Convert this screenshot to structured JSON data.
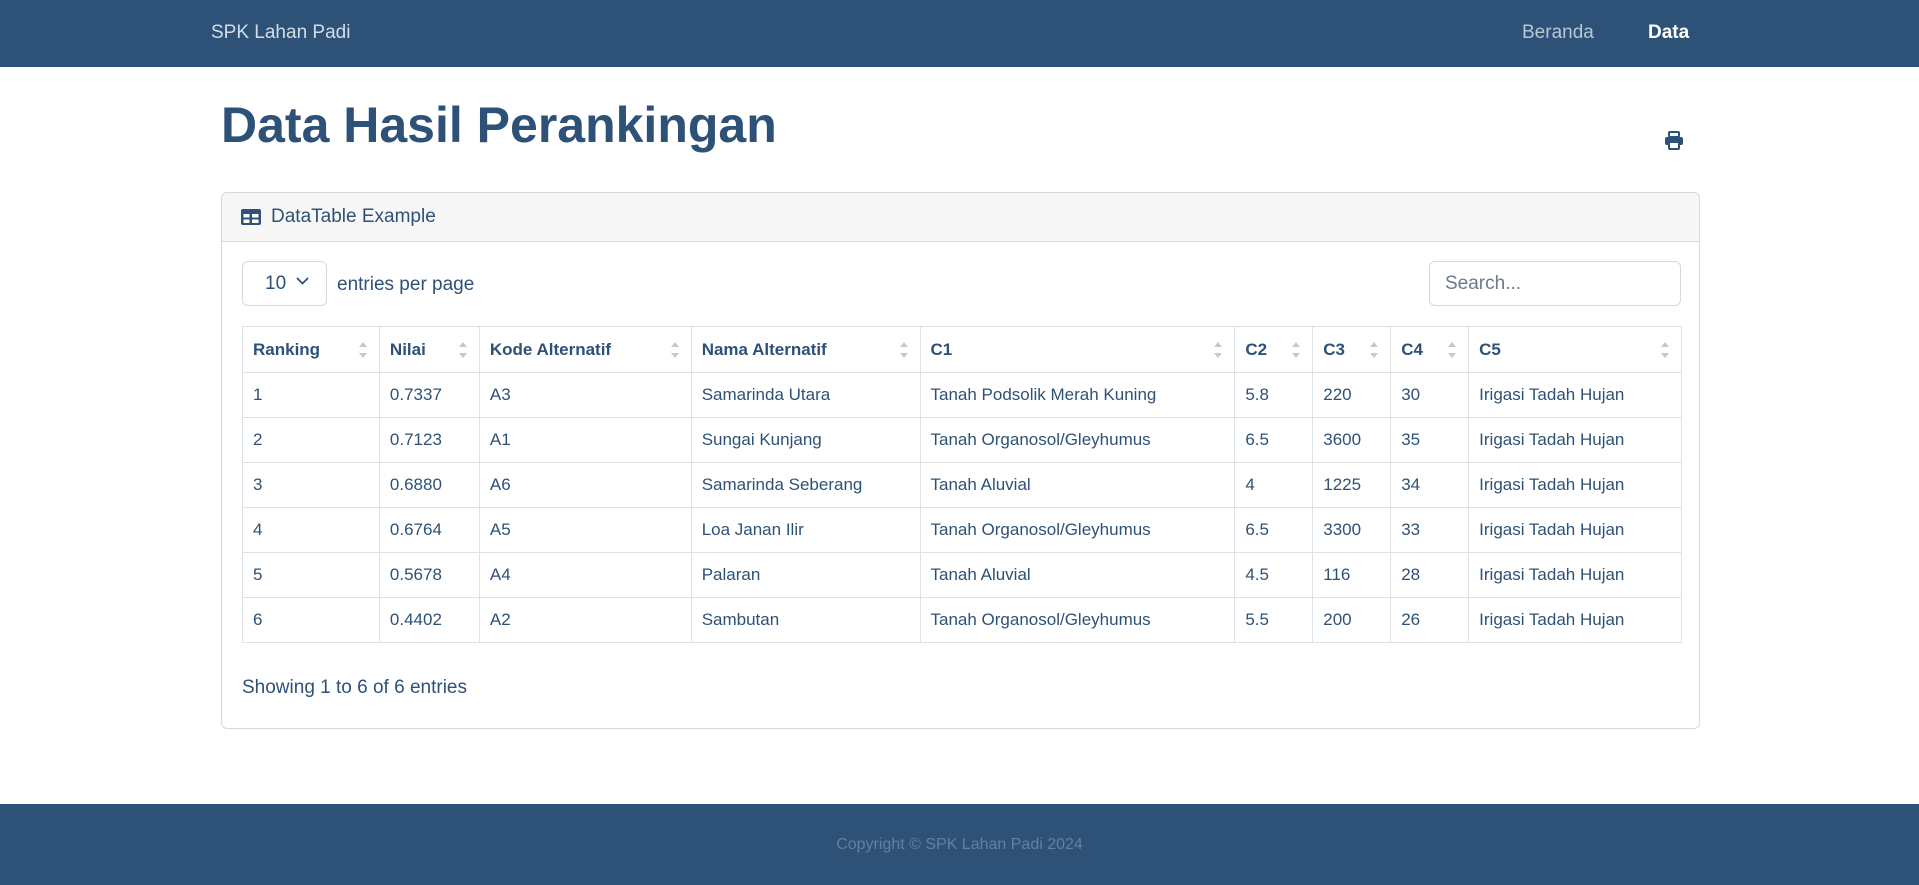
{
  "navbar": {
    "brand": "SPK Lahan Padi",
    "links": [
      {
        "label": "Beranda",
        "active": false
      },
      {
        "label": "Data",
        "active": true
      }
    ]
  },
  "page": {
    "title": "Data Hasil Perankingan",
    "print_icon": "print-icon"
  },
  "card": {
    "header_icon": "table-icon",
    "header_label": "DataTable Example",
    "per_page_value": "10",
    "per_page_label": "entries per page",
    "search_placeholder": "Search...",
    "search_value": "",
    "columns": [
      "Ranking",
      "Nilai",
      "Kode Alternatif",
      "Nama Alternatif",
      "C1",
      "C2",
      "C3",
      "C4",
      "C5"
    ],
    "rows": [
      [
        "1",
        "0.7337",
        "A3",
        "Samarinda Utara",
        "Tanah Podsolik Merah Kuning",
        "5.8",
        "220",
        "30",
        "Irigasi Tadah Hujan"
      ],
      [
        "2",
        "0.7123",
        "A1",
        "Sungai Kunjang",
        "Tanah Organosol/Gleyhumus",
        "6.5",
        "3600",
        "35",
        "Irigasi Tadah Hujan"
      ],
      [
        "3",
        "0.6880",
        "A6",
        "Samarinda Seberang",
        "Tanah Aluvial",
        "4",
        "1225",
        "34",
        "Irigasi Tadah Hujan"
      ],
      [
        "4",
        "0.6764",
        "A5",
        "Loa Janan Ilir",
        "Tanah Organosol/Gleyhumus",
        "6.5",
        "3300",
        "33",
        "Irigasi Tadah Hujan"
      ],
      [
        "5",
        "0.5678",
        "A4",
        "Palaran",
        "Tanah Aluvial",
        "4.5",
        "116",
        "28",
        "Irigasi Tadah Hujan"
      ],
      [
        "6",
        "0.4402",
        "A2",
        "Sambutan",
        "Tanah Organosol/Gleyhumus",
        "5.5",
        "200",
        "26",
        "Irigasi Tadah Hujan"
      ]
    ],
    "info": "Showing 1 to 6 of 6 entries"
  },
  "footer": {
    "copyright": "Copyright © SPK Lahan Padi 2024"
  },
  "colors": {
    "primary": "#2e5177",
    "footer_text": "#62809f",
    "border": "#d4d9df"
  }
}
